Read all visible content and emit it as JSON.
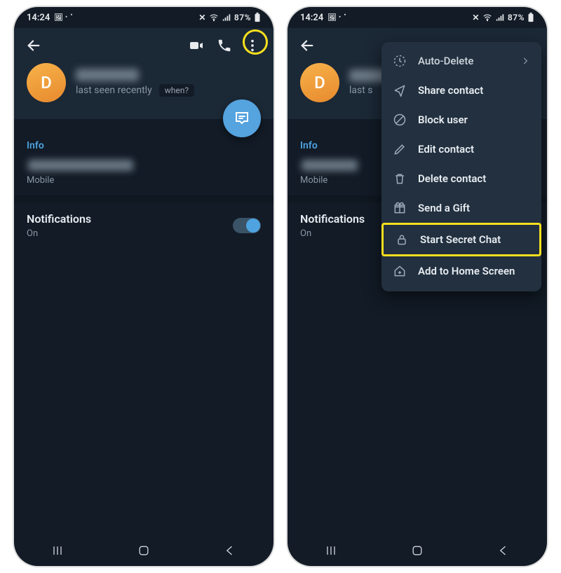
{
  "status": {
    "time": "14:24",
    "battery": "87%"
  },
  "profile": {
    "avatar_letter": "D",
    "last_seen": "last seen recently",
    "when_label": "when?"
  },
  "info": {
    "title": "Info",
    "phone_type": "Mobile"
  },
  "notifications": {
    "label": "Notifications",
    "state": "On"
  },
  "menu": {
    "auto_delete": "Auto-Delete",
    "share": "Share contact",
    "block": "Block user",
    "edit": "Edit contact",
    "delete": "Delete contact",
    "gift": "Send a Gift",
    "secret": "Start Secret Chat",
    "home": "Add to Home Screen"
  }
}
